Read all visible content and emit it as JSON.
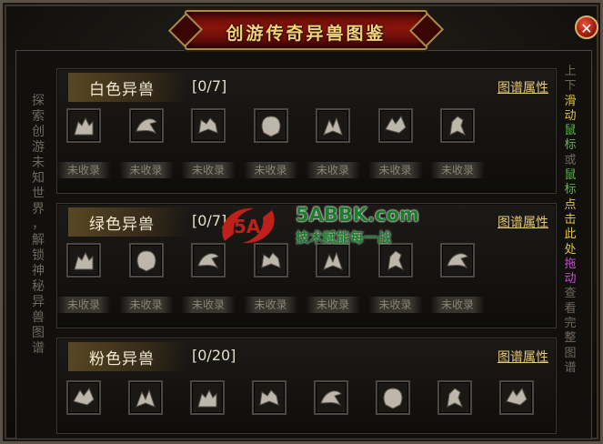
{
  "window": {
    "title": "创游传奇异兽图鉴",
    "close_glyph": "✕"
  },
  "sidebar_left": {
    "chars": [
      "探",
      "索",
      "创",
      "游",
      "未",
      "知",
      "世",
      "界",
      "，",
      "解",
      "锁",
      "神",
      "秘",
      "异",
      "兽",
      "图",
      "谱"
    ]
  },
  "sidebar_right": {
    "chars": [
      {
        "c": "上",
        "color": "#6e675c"
      },
      {
        "c": "下",
        "color": "#6e675c"
      },
      {
        "c": "滑",
        "color": "#e0c243"
      },
      {
        "c": "动",
        "color": "#e0c243"
      },
      {
        "c": "鼠",
        "color": "#5fb84a"
      },
      {
        "c": "标",
        "color": "#5fb84a"
      },
      {
        "c": "或",
        "color": "#6e675c"
      },
      {
        "c": "鼠",
        "color": "#5fb84a"
      },
      {
        "c": "标",
        "color": "#5fb84a"
      },
      {
        "c": "点",
        "color": "#e0c243"
      },
      {
        "c": "击",
        "color": "#e0c243"
      },
      {
        "c": "此",
        "color": "#e0c243"
      },
      {
        "c": "处",
        "color": "#e0c243"
      },
      {
        "c": "拖",
        "color": "#c648d8"
      },
      {
        "c": "动",
        "color": "#c648d8"
      },
      {
        "c": "查",
        "color": "#6e675c"
      },
      {
        "c": "看",
        "color": "#6e675c"
      },
      {
        "c": "完",
        "color": "#6e675c"
      },
      {
        "c": "整",
        "color": "#6e675c"
      },
      {
        "c": "图",
        "color": "#6e675c"
      },
      {
        "c": "谱",
        "color": "#6e675c"
      }
    ]
  },
  "sections": [
    {
      "name": "白色异兽",
      "count": "[0/7]",
      "link": "图谱属性",
      "items": [
        {
          "icon": "wolf-icon",
          "status": "未收录"
        },
        {
          "icon": "eagle-icon",
          "status": "未收录"
        },
        {
          "icon": "tiger-icon",
          "status": "未收录"
        },
        {
          "icon": "lion-icon",
          "status": "未收录"
        },
        {
          "icon": "beast-icon",
          "status": "未收录"
        },
        {
          "icon": "dragon-icon",
          "status": "未收录"
        },
        {
          "icon": "horse-icon",
          "status": "未收录"
        }
      ]
    },
    {
      "name": "绿色异兽",
      "count": "[0/7]",
      "link": "图谱属性",
      "items": [
        {
          "icon": "wolf-icon",
          "status": "未收录"
        },
        {
          "icon": "lion-icon",
          "status": "未收录"
        },
        {
          "icon": "eagle-icon",
          "status": "未收录"
        },
        {
          "icon": "tiger-icon",
          "status": "未收录"
        },
        {
          "icon": "beast-icon",
          "status": "未收录"
        },
        {
          "icon": "horse-icon",
          "status": "未收录"
        },
        {
          "icon": "eagle-icon",
          "status": "未收录"
        }
      ]
    },
    {
      "name": "粉色异兽",
      "count": "[0/20]",
      "link": "图谱属性",
      "items": [
        {
          "icon": "dragon-icon"
        },
        {
          "icon": "beast-icon"
        },
        {
          "icon": "wolf-icon"
        },
        {
          "icon": "tiger-icon"
        },
        {
          "icon": "eagle-icon"
        },
        {
          "icon": "lion-icon"
        },
        {
          "icon": "horse-icon"
        },
        {
          "icon": "dragon-icon"
        }
      ]
    }
  ],
  "watermark": {
    "domain": "5ABBK.com",
    "slogan": "技术赋能每一战",
    "logo_text": "5A"
  },
  "colors": {
    "accent_gold": "#e6c978",
    "title_red": "#8a140c",
    "watermark_green": "#1e7b2e"
  }
}
